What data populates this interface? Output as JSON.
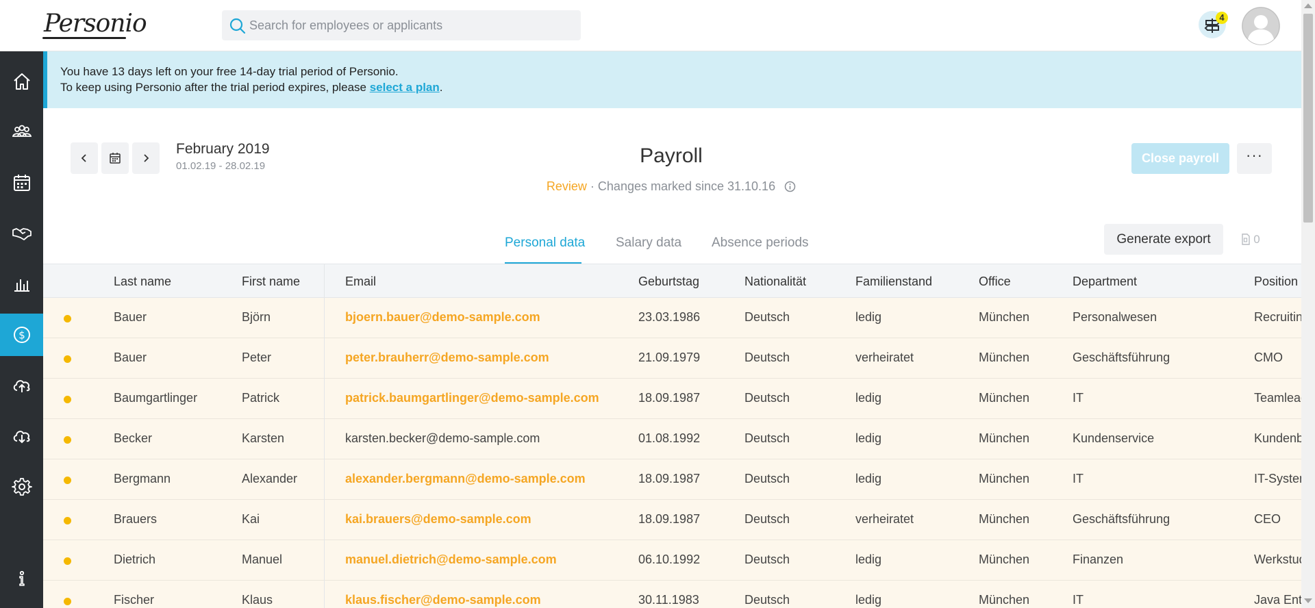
{
  "app": {
    "logo": "Personio",
    "search_placeholder": "Search for employees or applicants",
    "notification_count": "4"
  },
  "banner": {
    "line1": "You have 13 days left on your free 14-day trial period of Personio.",
    "line2_prefix": "To keep using Personio after the trial period expires, please ",
    "line2_link": "select a plan",
    "line2_suffix": "."
  },
  "sidebar": {
    "items": [
      {
        "icon": "home-icon"
      },
      {
        "icon": "people-icon"
      },
      {
        "icon": "calendar-icon"
      },
      {
        "icon": "handshake-icon"
      },
      {
        "icon": "bar-chart-icon"
      },
      {
        "icon": "dollar-icon",
        "active": true
      },
      {
        "icon": "cloud-upload-icon"
      },
      {
        "icon": "cloud-download-icon"
      },
      {
        "icon": "gear-icon"
      },
      {
        "icon": "info-icon"
      }
    ]
  },
  "header": {
    "period_title": "February 2019",
    "period_range": "01.02.19 - 28.02.19",
    "page_title": "Payroll",
    "status_word": "Review",
    "status_rest": " · Changes marked since 31.10.16",
    "close_button": "Close payroll",
    "more_button": "···"
  },
  "tabs": [
    {
      "label": "Personal data",
      "active": true
    },
    {
      "label": "Salary data"
    },
    {
      "label": "Absence periods"
    }
  ],
  "actions": {
    "export_button": "Generate export",
    "document_count": "0"
  },
  "table": {
    "columns": [
      "Last name",
      "First name",
      "Email",
      "Geburtstag",
      "Nationalität",
      "Familienstand",
      "Office",
      "Department",
      "Position"
    ],
    "rows": [
      {
        "last": "Bauer",
        "first": "Björn",
        "email": "bjoern.bauer@demo-sample.com",
        "email_highlight": true,
        "birthday": "23.03.1986",
        "nationality": "Deutsch",
        "status": "ledig",
        "office": "München",
        "department": "Personalwesen",
        "position": "Recruiting"
      },
      {
        "last": "Bauer",
        "first": "Peter",
        "email": "peter.brauherr@demo-sample.com",
        "email_highlight": true,
        "birthday": "21.09.1979",
        "nationality": "Deutsch",
        "status": "verheiratet",
        "office": "München",
        "department": "Geschäftsführung",
        "position": "CMO"
      },
      {
        "last": "Baumgartlinger",
        "first": "Patrick",
        "email": "patrick.baumgartlinger@demo-sample.com",
        "email_highlight": true,
        "birthday": "18.09.1987",
        "nationality": "Deutsch",
        "status": "ledig",
        "office": "München",
        "department": "IT",
        "position": "Teamlead"
      },
      {
        "last": "Becker",
        "first": "Karsten",
        "email": "karsten.becker@demo-sample.com",
        "email_highlight": false,
        "birthday": "01.08.1992",
        "nationality": "Deutsch",
        "status": "ledig",
        "office": "München",
        "department": "Kundenservice",
        "position": "Kundenbetreuer"
      },
      {
        "last": "Bergmann",
        "first": "Alexander",
        "email": "alexander.bergmann@demo-sample.com",
        "email_highlight": true,
        "birthday": "18.09.1987",
        "nationality": "Deutsch",
        "status": "ledig",
        "office": "München",
        "department": "IT",
        "position": "IT-Systemadministrator"
      },
      {
        "last": "Brauers",
        "first": "Kai",
        "email": "kai.brauers@demo-sample.com",
        "email_highlight": true,
        "birthday": "18.09.1987",
        "nationality": "Deutsch",
        "status": "verheiratet",
        "office": "München",
        "department": "Geschäftsführung",
        "position": "CEO"
      },
      {
        "last": "Dietrich",
        "first": "Manuel",
        "email": "manuel.dietrich@demo-sample.com",
        "email_highlight": true,
        "birthday": "06.10.1992",
        "nationality": "Deutsch",
        "status": "ledig",
        "office": "München",
        "department": "Finanzen",
        "position": "Werkstudent"
      },
      {
        "last": "Fischer",
        "first": "Klaus",
        "email": "klaus.fischer@demo-sample.com",
        "email_highlight": true,
        "birthday": "30.11.1983",
        "nationality": "Deutsch",
        "status": "ledig",
        "office": "München",
        "department": "IT",
        "position": "Java Entwickler"
      }
    ]
  },
  "colors": {
    "accent": "#1ea7d6",
    "sidebar": "#2b2f33",
    "banner": "#d3eef6",
    "review": "#f5a623",
    "row_bg": "#fdf7ec",
    "dot": "#f5b800"
  }
}
